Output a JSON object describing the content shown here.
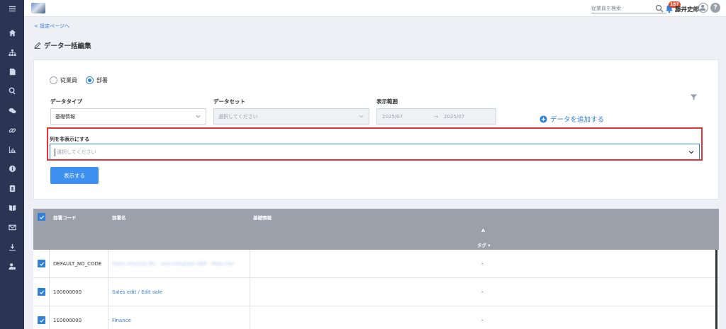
{
  "nav": {
    "items": [
      "home",
      "org-chart",
      "document",
      "search",
      "chat",
      "link",
      "chart",
      "info",
      "contacts",
      "book",
      "mail",
      "download",
      "user-settings"
    ]
  },
  "header": {
    "search_placeholder": "従業員を検索",
    "notification_count": "187",
    "user_name": "藤井史郎",
    "help_label": "?"
  },
  "breadcrumb": {
    "back_label": "< 設定ページへ"
  },
  "page": {
    "title": "データ一括編集"
  },
  "filters": {
    "radio_employee": "従業員",
    "radio_department": "部署",
    "selected_radio": "部署",
    "data_type_label": "データタイプ",
    "data_type_value": "基礎情報",
    "dataset_label": "データセット",
    "dataset_placeholder": "選択してください",
    "display_range_label": "表示範囲",
    "range_start": "2025/07",
    "range_arrow": "→",
    "range_end": "2025/07",
    "add_data_label": "データを追加する",
    "hide_columns_label": "列を非表示にする",
    "hide_columns_placeholder": "選択してください",
    "show_button": "表示する"
  },
  "table": {
    "headers": {
      "code": "部署コード",
      "name": "部署名",
      "basic_info": "基礎情報",
      "group": "A",
      "tag": "タグ ▾"
    },
    "rows": [
      {
        "code": "DEFAULT_NO_CODE",
        "name": "Sales Analysis BU - new template 2BR - Mate Fan",
        "blurred": true,
        "value": "-"
      },
      {
        "code": "100000000",
        "name": "Sales edit / Edit sale",
        "blurred": false,
        "value": "-"
      },
      {
        "code": "110000000",
        "name": "Finance",
        "blurred": false,
        "value": "-"
      }
    ]
  },
  "colors": {
    "sidebar": "#2b3553",
    "accent": "#2f7ed8",
    "highlight": "#e0353a",
    "table_header": "#9ca0ab"
  }
}
